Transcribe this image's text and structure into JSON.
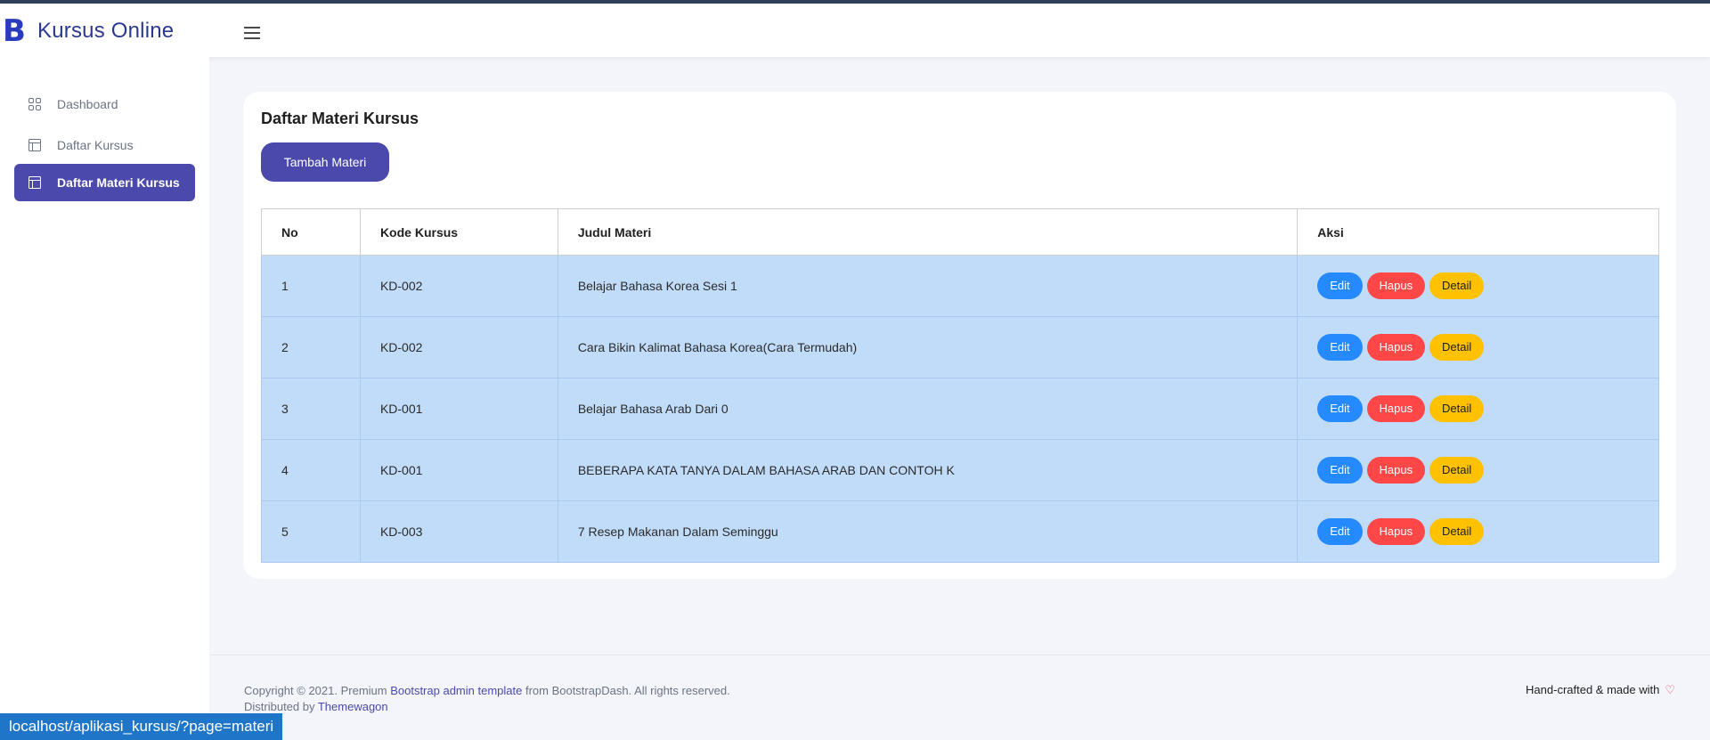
{
  "brand": {
    "logo_letter": "B",
    "name": "Kursus Online"
  },
  "sidebar": {
    "items": [
      {
        "label": "Dashboard",
        "icon": "grid-icon",
        "active": false
      },
      {
        "label": "Daftar Kursus",
        "icon": "layout-icon",
        "active": false
      },
      {
        "label": "Daftar Materi Kursus",
        "icon": "layout-icon",
        "active": true
      }
    ]
  },
  "main": {
    "title": "Daftar Materi Kursus",
    "add_button": "Tambah Materi",
    "table": {
      "headers": [
        "No",
        "Kode Kursus",
        "Judul Materi",
        "Aksi"
      ],
      "rows": [
        {
          "no": "1",
          "kode": "KD-002",
          "judul": "Belajar Bahasa Korea Sesi 1"
        },
        {
          "no": "2",
          "kode": "KD-002",
          "judul": "Cara Bikin Kalimat Bahasa Korea(Cara Termudah)"
        },
        {
          "no": "3",
          "kode": "KD-001",
          "judul": "Belajar Bahasa Arab Dari 0"
        },
        {
          "no": "4",
          "kode": "KD-001",
          "judul": "BEBERAPA KATA TANYA DALAM BAHASA ARAB DAN CONTOH K"
        },
        {
          "no": "5",
          "kode": "KD-003",
          "judul": "7 Resep Makanan Dalam Seminggu"
        }
      ],
      "actions": {
        "edit": "Edit",
        "delete": "Hapus",
        "detail": "Detail"
      }
    }
  },
  "footer": {
    "copyright_prefix": "Copyright © 2021. Premium ",
    "template_link": "Bootstrap admin template",
    "copyright_suffix": " from BootstrapDash. All rights reserved.",
    "distributed_prefix": "Distributed by ",
    "distributor_link": "Themewagon",
    "crafted": "Hand-crafted & made with",
    "heart_symbol": "♡"
  },
  "statusbar": {
    "url": "localhost/aplikasi_kursus/?page=materi"
  },
  "colors": {
    "primary": "#4b49ac",
    "edit": "#248afd",
    "delete": "#ff4747",
    "detail": "#ffc100",
    "row_bg": "#c0dcf9"
  }
}
